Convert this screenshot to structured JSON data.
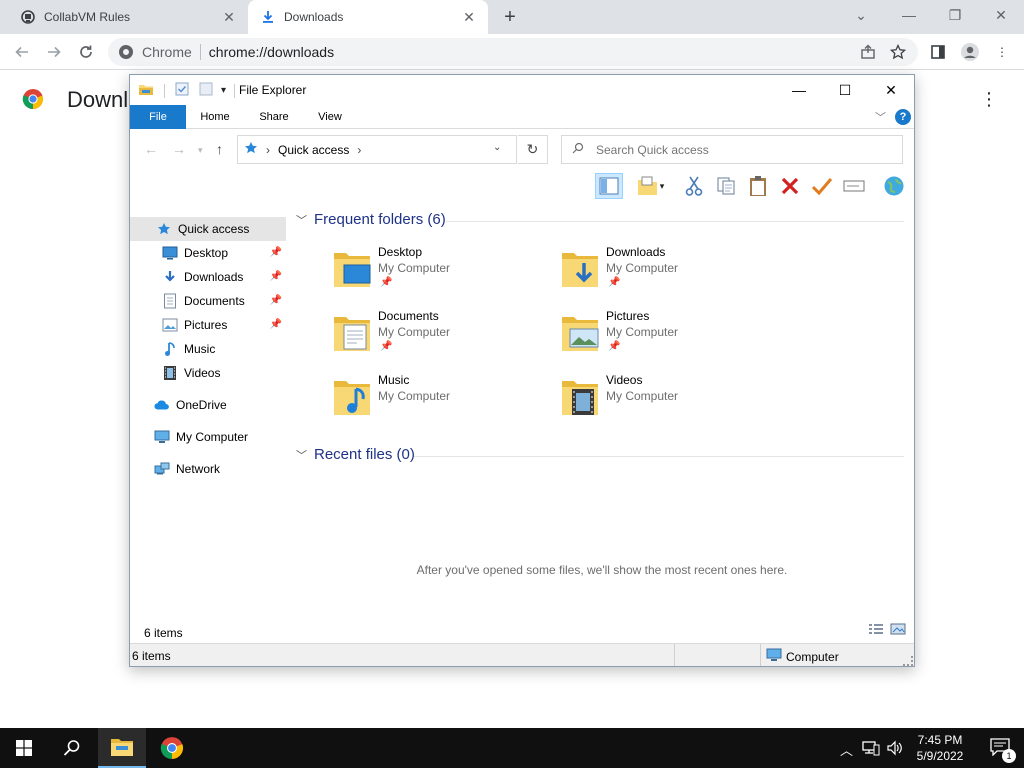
{
  "chrome": {
    "tabs": [
      {
        "title": "CollabVM Rules",
        "icon": "collabvm-icon"
      },
      {
        "title": "Downloads",
        "icon": "download-icon"
      }
    ],
    "omnibox": {
      "scheme_label": "Chrome",
      "url": "chrome://downloads"
    },
    "page_title": "Downloads"
  },
  "explorer": {
    "title": "File Explorer",
    "ribbon_tabs": [
      "File",
      "Home",
      "Share",
      "View"
    ],
    "breadcrumb": "Quick access",
    "search_placeholder": "Search Quick access",
    "nav": [
      {
        "label": "Quick access",
        "icon": "star-icon"
      },
      {
        "label": "Desktop",
        "icon": "desktop-icon"
      },
      {
        "label": "Downloads",
        "icon": "download-arrow-icon"
      },
      {
        "label": "Documents",
        "icon": "document-icon"
      },
      {
        "label": "Pictures",
        "icon": "pictures-icon"
      },
      {
        "label": "Music",
        "icon": "music-icon"
      },
      {
        "label": "Videos",
        "icon": "film-icon"
      },
      {
        "label": "OneDrive",
        "icon": "cloud-icon"
      },
      {
        "label": "My Computer",
        "icon": "computer-icon"
      },
      {
        "label": "Network",
        "icon": "network-icon"
      }
    ],
    "frequent_header": "Frequent folders (6)",
    "folders": [
      {
        "name": "Desktop",
        "location": "My Computer",
        "icon": "desktop-folder-icon"
      },
      {
        "name": "Downloads",
        "location": "My Computer",
        "icon": "downloads-folder-icon"
      },
      {
        "name": "Documents",
        "location": "My Computer",
        "icon": "documents-folder-icon"
      },
      {
        "name": "Pictures",
        "location": "My Computer",
        "icon": "pictures-folder-icon"
      },
      {
        "name": "Music",
        "location": "My Computer",
        "icon": "music-folder-icon"
      },
      {
        "name": "Videos",
        "location": "My Computer",
        "icon": "videos-folder-icon"
      }
    ],
    "recent_header": "Recent files (0)",
    "recent_empty": "After you've opened some files, we'll show the most recent ones here.",
    "status_items": "6 items",
    "statusbar_items": "6 items",
    "statusbar_location": "Computer"
  },
  "taskbar": {
    "time": "7:45 PM",
    "date": "5/9/2022",
    "notification_count": "1"
  },
  "colors": {
    "accent": "#1979ca",
    "tabstrip": "#dee1e6",
    "taskbar": "#101010",
    "group_header": "#1e3287"
  }
}
